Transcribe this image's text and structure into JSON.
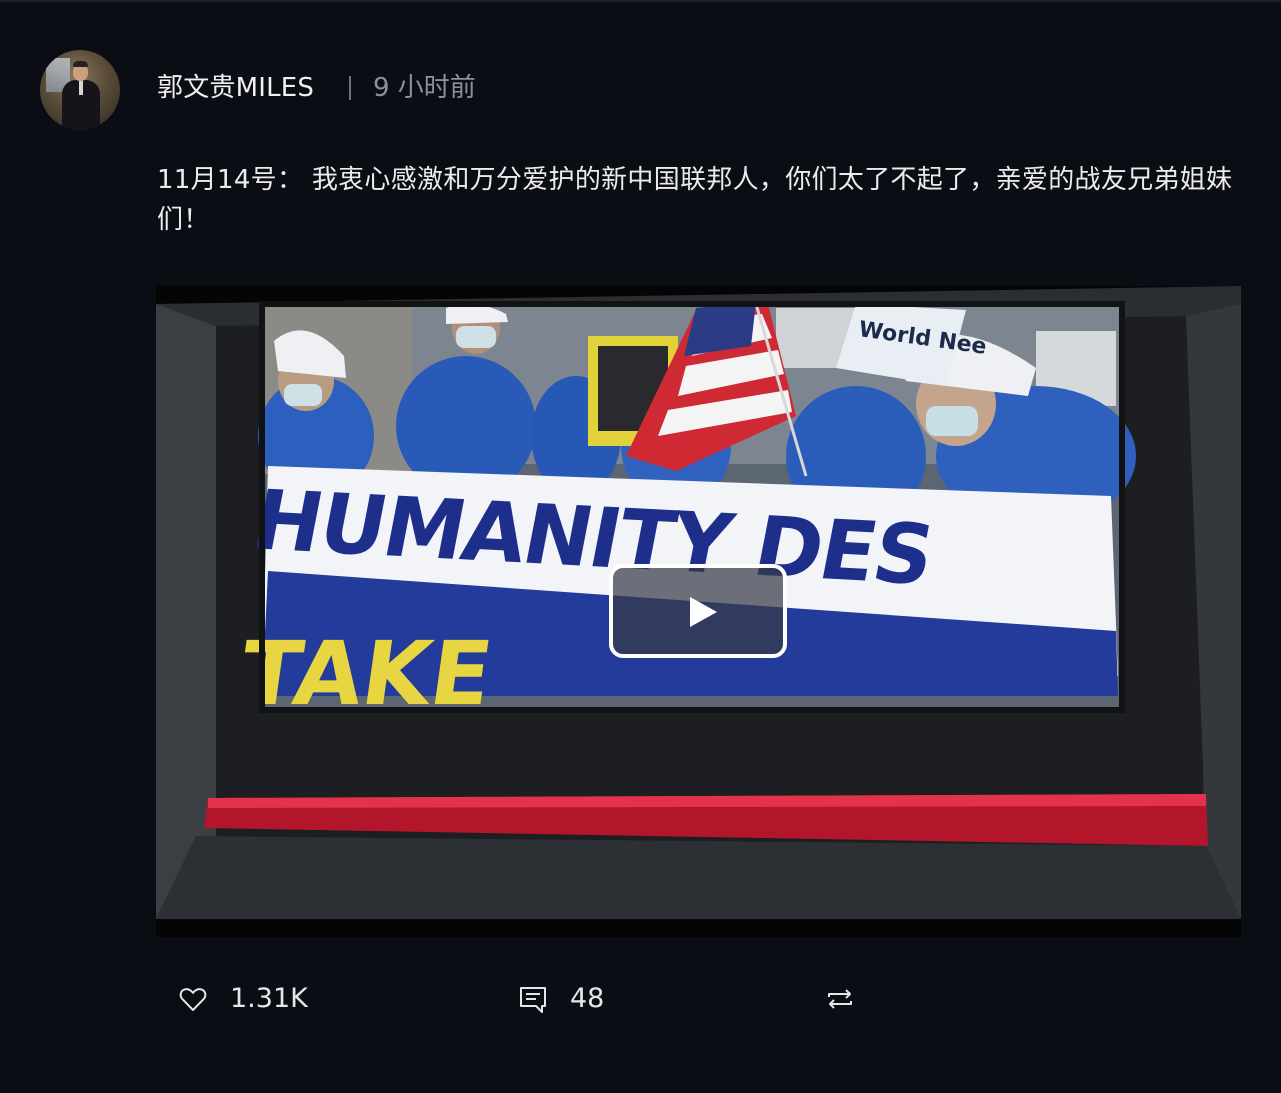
{
  "post": {
    "author": "郭文贵MILES",
    "time": "9 小时前",
    "text": "11月14号： 我衷心感激和万分爱护的新中国联邦人，你们太了不起了，亲爱的战友兄弟姐妹们！"
  },
  "video": {
    "banner_text": "HUMANITY DES",
    "banner_sub_text": "TAKE",
    "sign_text": "World Nee"
  },
  "actions": {
    "like_count": "1.31K",
    "comment_count": "48",
    "like_icon": "heart-icon",
    "comment_icon": "comment-icon",
    "share_icon": "repost-icon"
  },
  "colors": {
    "background": "#0b0d14",
    "text": "#ececee",
    "muted": "#8d909b"
  }
}
